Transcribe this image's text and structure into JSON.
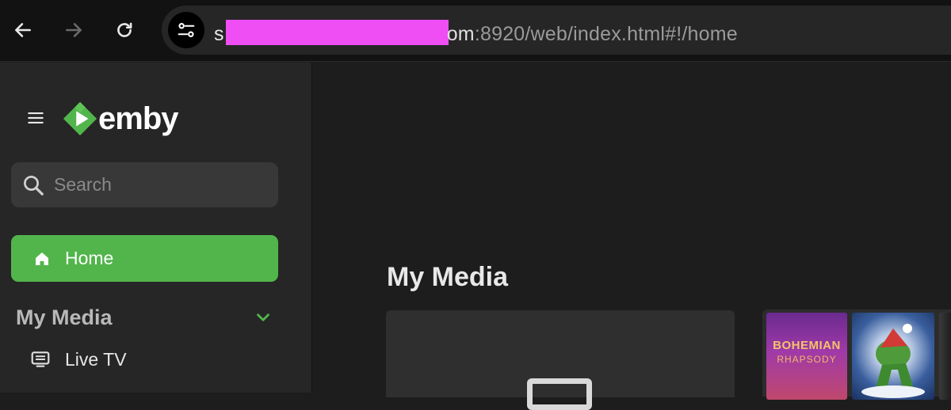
{
  "browser": {
    "url_first_char": "s",
    "url_rest_highlight": "om",
    "url_rest": ":8920/web/index.html#!/home"
  },
  "sidebar": {
    "logo_text": "emby",
    "search_placeholder": "Search",
    "home_label": "Home",
    "section_title": "My Media",
    "items": [
      {
        "label": "Live TV"
      }
    ]
  },
  "main": {
    "title": "My Media",
    "posters": [
      {
        "title": "BOHEMIAN",
        "subtitle": "RHAPSODY"
      }
    ]
  },
  "colors": {
    "accent": "#52b54b",
    "redaction": "#ef4ef5"
  }
}
